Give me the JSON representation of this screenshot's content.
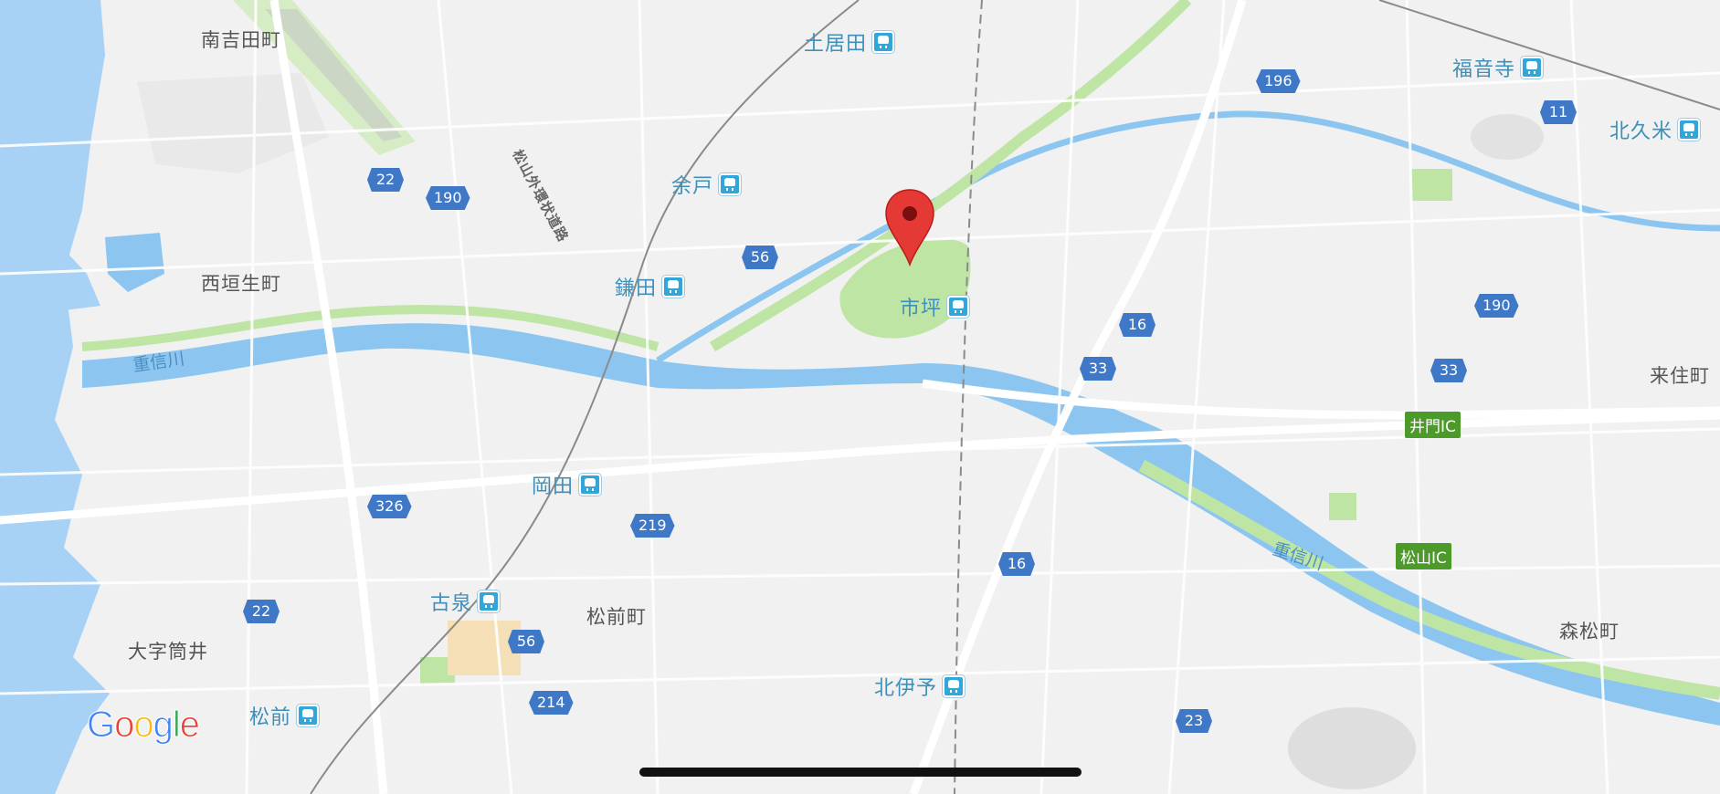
{
  "map": {
    "places": [
      {
        "id": "minami-yoshida",
        "text": "南吉田町"
      },
      {
        "id": "nishi-gaiu",
        "text": "西垣生町"
      },
      {
        "id": "oaza-tsutsui",
        "text": "大字筒井"
      },
      {
        "id": "masaki",
        "text": "松前町"
      },
      {
        "id": "morimatsu",
        "text": "森松町"
      },
      {
        "id": "kisumi",
        "text": "来住町"
      }
    ],
    "stations": [
      {
        "id": "doida",
        "name": "土居田"
      },
      {
        "id": "yodo",
        "name": "余戸"
      },
      {
        "id": "kamata",
        "name": "鎌田"
      },
      {
        "id": "ichitsubo",
        "name": "市坪"
      },
      {
        "id": "okada",
        "name": "岡田"
      },
      {
        "id": "koizumi",
        "name": "古泉"
      },
      {
        "id": "masaki-st",
        "name": "松前"
      },
      {
        "id": "kitaiyo",
        "name": "北伊予"
      },
      {
        "id": "fukuonji",
        "name": "福音寺"
      },
      {
        "id": "kitakume",
        "name": "北久米"
      }
    ],
    "routes": [
      {
        "id": "r22a",
        "number": "22"
      },
      {
        "id": "r190a",
        "number": "190"
      },
      {
        "id": "r56a",
        "number": "56"
      },
      {
        "id": "r196",
        "number": "196"
      },
      {
        "id": "r11",
        "number": "11"
      },
      {
        "id": "r16a",
        "number": "16"
      },
      {
        "id": "r33a",
        "number": "33"
      },
      {
        "id": "r190b",
        "number": "190"
      },
      {
        "id": "r33b",
        "number": "33"
      },
      {
        "id": "r326",
        "number": "326"
      },
      {
        "id": "r219",
        "number": "219"
      },
      {
        "id": "r16b",
        "number": "16"
      },
      {
        "id": "r22b",
        "number": "22"
      },
      {
        "id": "r56b",
        "number": "56"
      },
      {
        "id": "r214",
        "number": "214"
      },
      {
        "id": "r23",
        "number": "23"
      }
    ],
    "interchanges": [
      {
        "id": "imon-ic",
        "text": "井門IC"
      },
      {
        "id": "matsuyama-ic",
        "text": "松山IC"
      }
    ],
    "rivers": [
      {
        "id": "shigenobu-west",
        "text": "重信川"
      },
      {
        "id": "shigenobu-east",
        "text": "重信川"
      }
    ],
    "road_names": [
      {
        "id": "matsuyama-outer-ring",
        "text": "松山外環状道路"
      }
    ],
    "logo": "Google",
    "colors": {
      "water": "#8cc6f0",
      "sea": "#a7d2f5",
      "park": "#bfe5a5",
      "route_shield": "#3f78c6",
      "station_icon": "#32a6d9",
      "pin": "#e53935",
      "ic_badge": "#4c9a2a"
    },
    "icons": {
      "pin": "map-pin-icon",
      "station": "train-station-icon"
    }
  }
}
